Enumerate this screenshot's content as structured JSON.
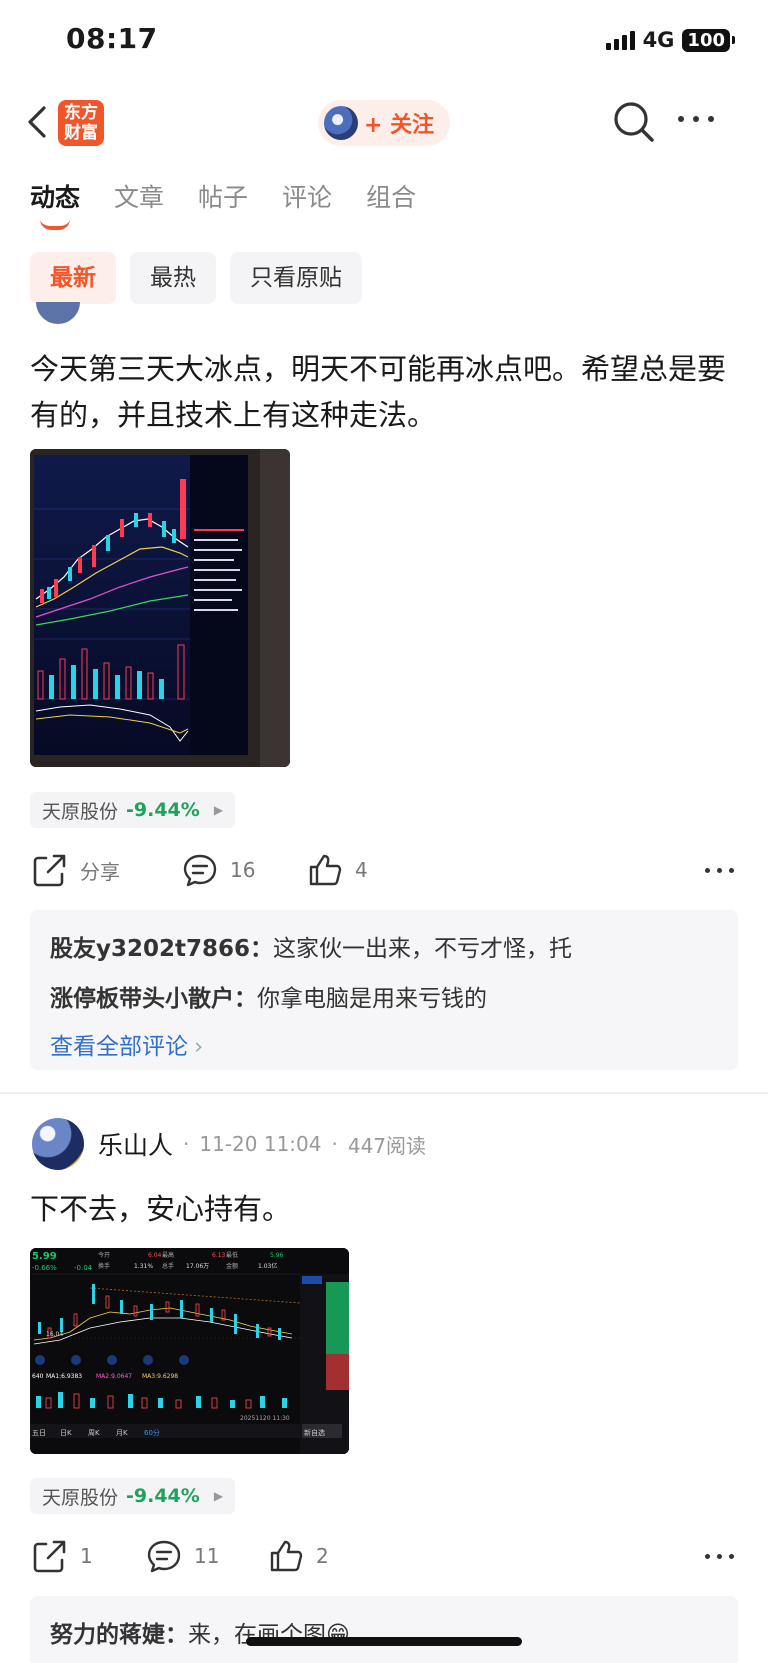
{
  "status": {
    "time": "08:17",
    "network": "4G",
    "battery": "100"
  },
  "nav": {
    "logo": "东方财富",
    "follow": "+ 关注"
  },
  "tabs": [
    "动态",
    "文章",
    "帖子",
    "评论",
    "组合"
  ],
  "filters": [
    "最新",
    "最热",
    "只看原贴"
  ],
  "posts": [
    {
      "text": "今天第三天大冰点，明天不可能再冰点吧。希望总是要有的，并且技术上有这种走法。",
      "stock": {
        "name": "天原股份",
        "change": "-9.44%"
      },
      "actions": {
        "share": "分享",
        "comments": "16",
        "likes": "4"
      },
      "comments": [
        {
          "user": "股友y3202t7866：",
          "text": "这家伙一出来，不亏才怪，托"
        },
        {
          "user": "涨停板带头小散户：",
          "text": "你拿电脑是用来亏钱的"
        }
      ],
      "view_all": "查看全部评论"
    },
    {
      "author": "乐山人",
      "time": "11-20 11:04",
      "reads": "447阅读",
      "text": "下不去，安心持有。",
      "stock": {
        "name": "天原股份",
        "change": "-9.44%"
      },
      "actions": {
        "share": "1",
        "comments": "11",
        "likes": "2"
      },
      "comments": [
        {
          "user": "努力的蒋婕：",
          "text": "来，在画个图😁"
        }
      ]
    }
  ],
  "screenshot2": {
    "price": "5.99",
    "change": "-0.66%",
    "change_abs": "-0.04",
    "open_label": "今开",
    "open": "6.04",
    "high_label": "最高",
    "high": "6.13",
    "low_label": "最低",
    "low": "5.96",
    "vol_label": "总手",
    "vol": "17.06万",
    "turnover_label": "换手",
    "turnover": "1.31%",
    "amount_label": "金额",
    "amount": "1.03亿",
    "ma1": "MA1:6.9383",
    "ma2": "MA2:9.0647",
    "ma3": "MA3:9.6298",
    "time_label": "20251120 11:30",
    "periods": [
      "五日",
      "日K",
      "周K",
      "月K",
      "60分"
    ],
    "add_label": "新自选"
  },
  "colors": {
    "accent": "#f0562a",
    "down": "#1fa25a",
    "link": "#2f6fd1"
  }
}
